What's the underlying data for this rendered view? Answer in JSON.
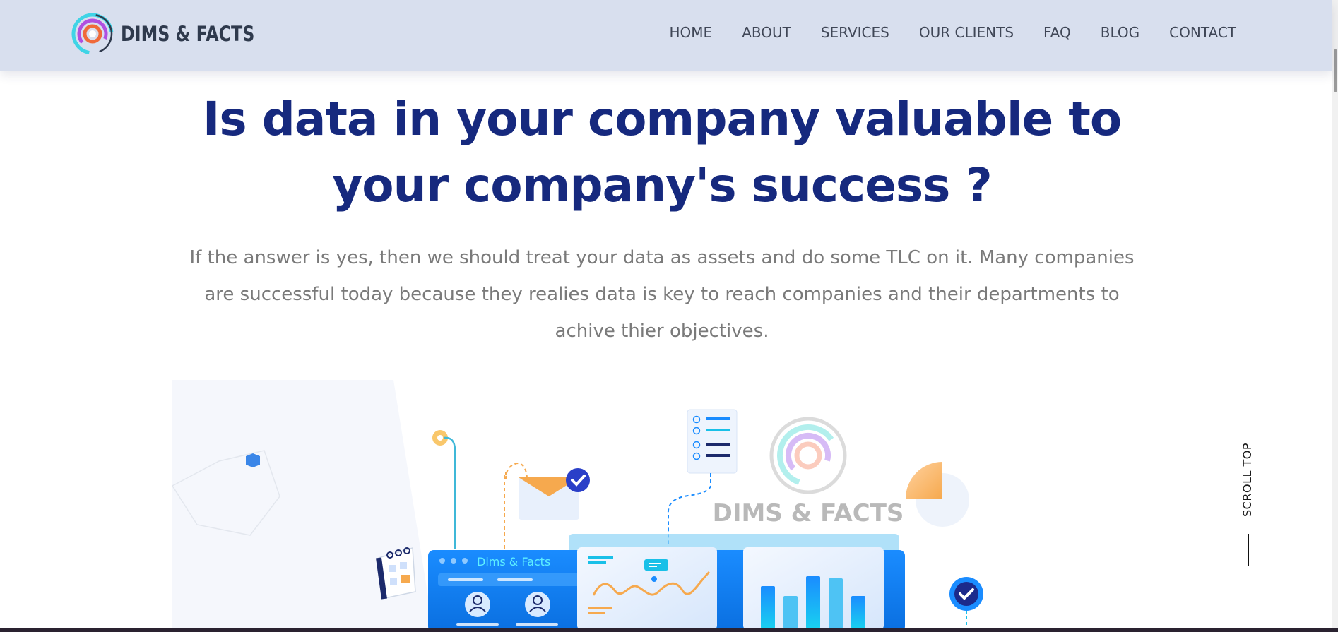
{
  "brand": {
    "name": "DIMS & FACTS",
    "logo_icon": "concentric-rings-logo-icon",
    "colors": {
      "header_bg": "#d8dfee",
      "headline": "#16297e",
      "body_text": "#7a7a7a",
      "accent_blue": "#1a8cff",
      "accent_cyan": "#3fd4e6",
      "accent_orange": "#f6a94e",
      "accent_purple": "#8a5cf6"
    }
  },
  "nav": {
    "items": [
      {
        "label": "HOME"
      },
      {
        "label": "ABOUT"
      },
      {
        "label": "SERVICES"
      },
      {
        "label": "OUR CLIENTS"
      },
      {
        "label": "FAQ"
      },
      {
        "label": "BLOG"
      },
      {
        "label": "CONTACT"
      }
    ]
  },
  "hero": {
    "headline_line1": "Is data in your company valuable to",
    "headline_line2": "your company's success ?",
    "lead_line1": "If the answer is yes, then we should treat your data as assets and do some TLC on it. Many companies",
    "lead_line2": "are successful today because they realies data is key to reach companies and their departments to",
    "lead_line3": "achive thier objectives."
  },
  "illustration": {
    "watermark_text": "DIMS & FACTS",
    "app_window_title": "Dims & Facts",
    "chart_bar_levels": [
      0.72,
      0.55,
      0.88,
      0.85,
      0.55
    ],
    "icons": [
      "hexagon-icon",
      "calendar-icon",
      "envelope-icon",
      "checkmark-badge-icon",
      "checklist-doc-icon",
      "pie-chart-icon",
      "user-avatar-icon",
      "chat-bubble-icon",
      "pin-icon"
    ]
  },
  "scroll_top": {
    "label": "SCROLL TOP"
  }
}
